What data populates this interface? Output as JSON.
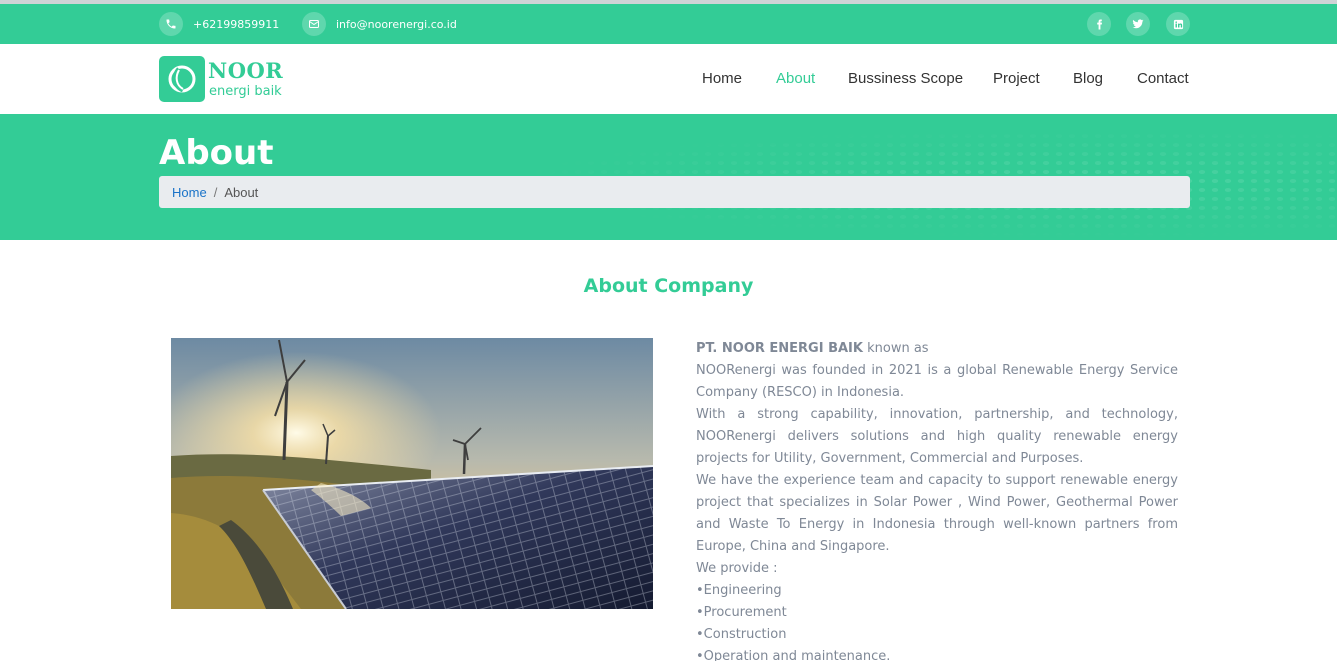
{
  "topbar": {
    "phone": "+62199859911",
    "email": "info@noorenergi.co.id",
    "social": [
      "facebook-icon",
      "twitter-icon",
      "linkedin-icon"
    ]
  },
  "logo": {
    "name": "NOOR",
    "subtitle": "energi baik"
  },
  "nav": {
    "items": [
      {
        "label": "Home",
        "active": false
      },
      {
        "label": "About",
        "active": true
      },
      {
        "label": "Bussiness Scope",
        "active": false
      },
      {
        "label": "Project",
        "active": false
      },
      {
        "label": "Blog",
        "active": false
      },
      {
        "label": "Contact",
        "active": false
      }
    ]
  },
  "hero": {
    "title": "About",
    "breadcrumb": {
      "home": "Home",
      "separator": "/",
      "current": "About"
    }
  },
  "section": {
    "title": "About Company"
  },
  "about": {
    "company": "PT. NOOR ENERGI BAIK",
    "intro_suffix": " known as",
    "para1": "NOORenergi was founded in 2021 is a global  Renewable Energy Service Company (RESCO) in  Indonesia.",
    "para2": "With a strong capability, innovation, partnership, and  technology, NOORenergi delivers solutions and  high quality renewable energy projects for Utility,  Government, Commercial and Purposes.",
    "para3": "We have the experience team and capacity to support  renewable energy project that specializes in Solar  Power , Wind Power, Geothermal Power and Waste To Energy in Indonesia  through well-known partners from Europe, China  and Singapore.",
    "provide_label": "We provide :",
    "services": [
      "•Engineering",
      "•Procurement",
      "•Construction",
      "•Operation and maintenance."
    ]
  },
  "colors": {
    "brand": "#33cc96",
    "breadcrumb_bg": "#e9ecef",
    "body_text": "#7f8896"
  }
}
